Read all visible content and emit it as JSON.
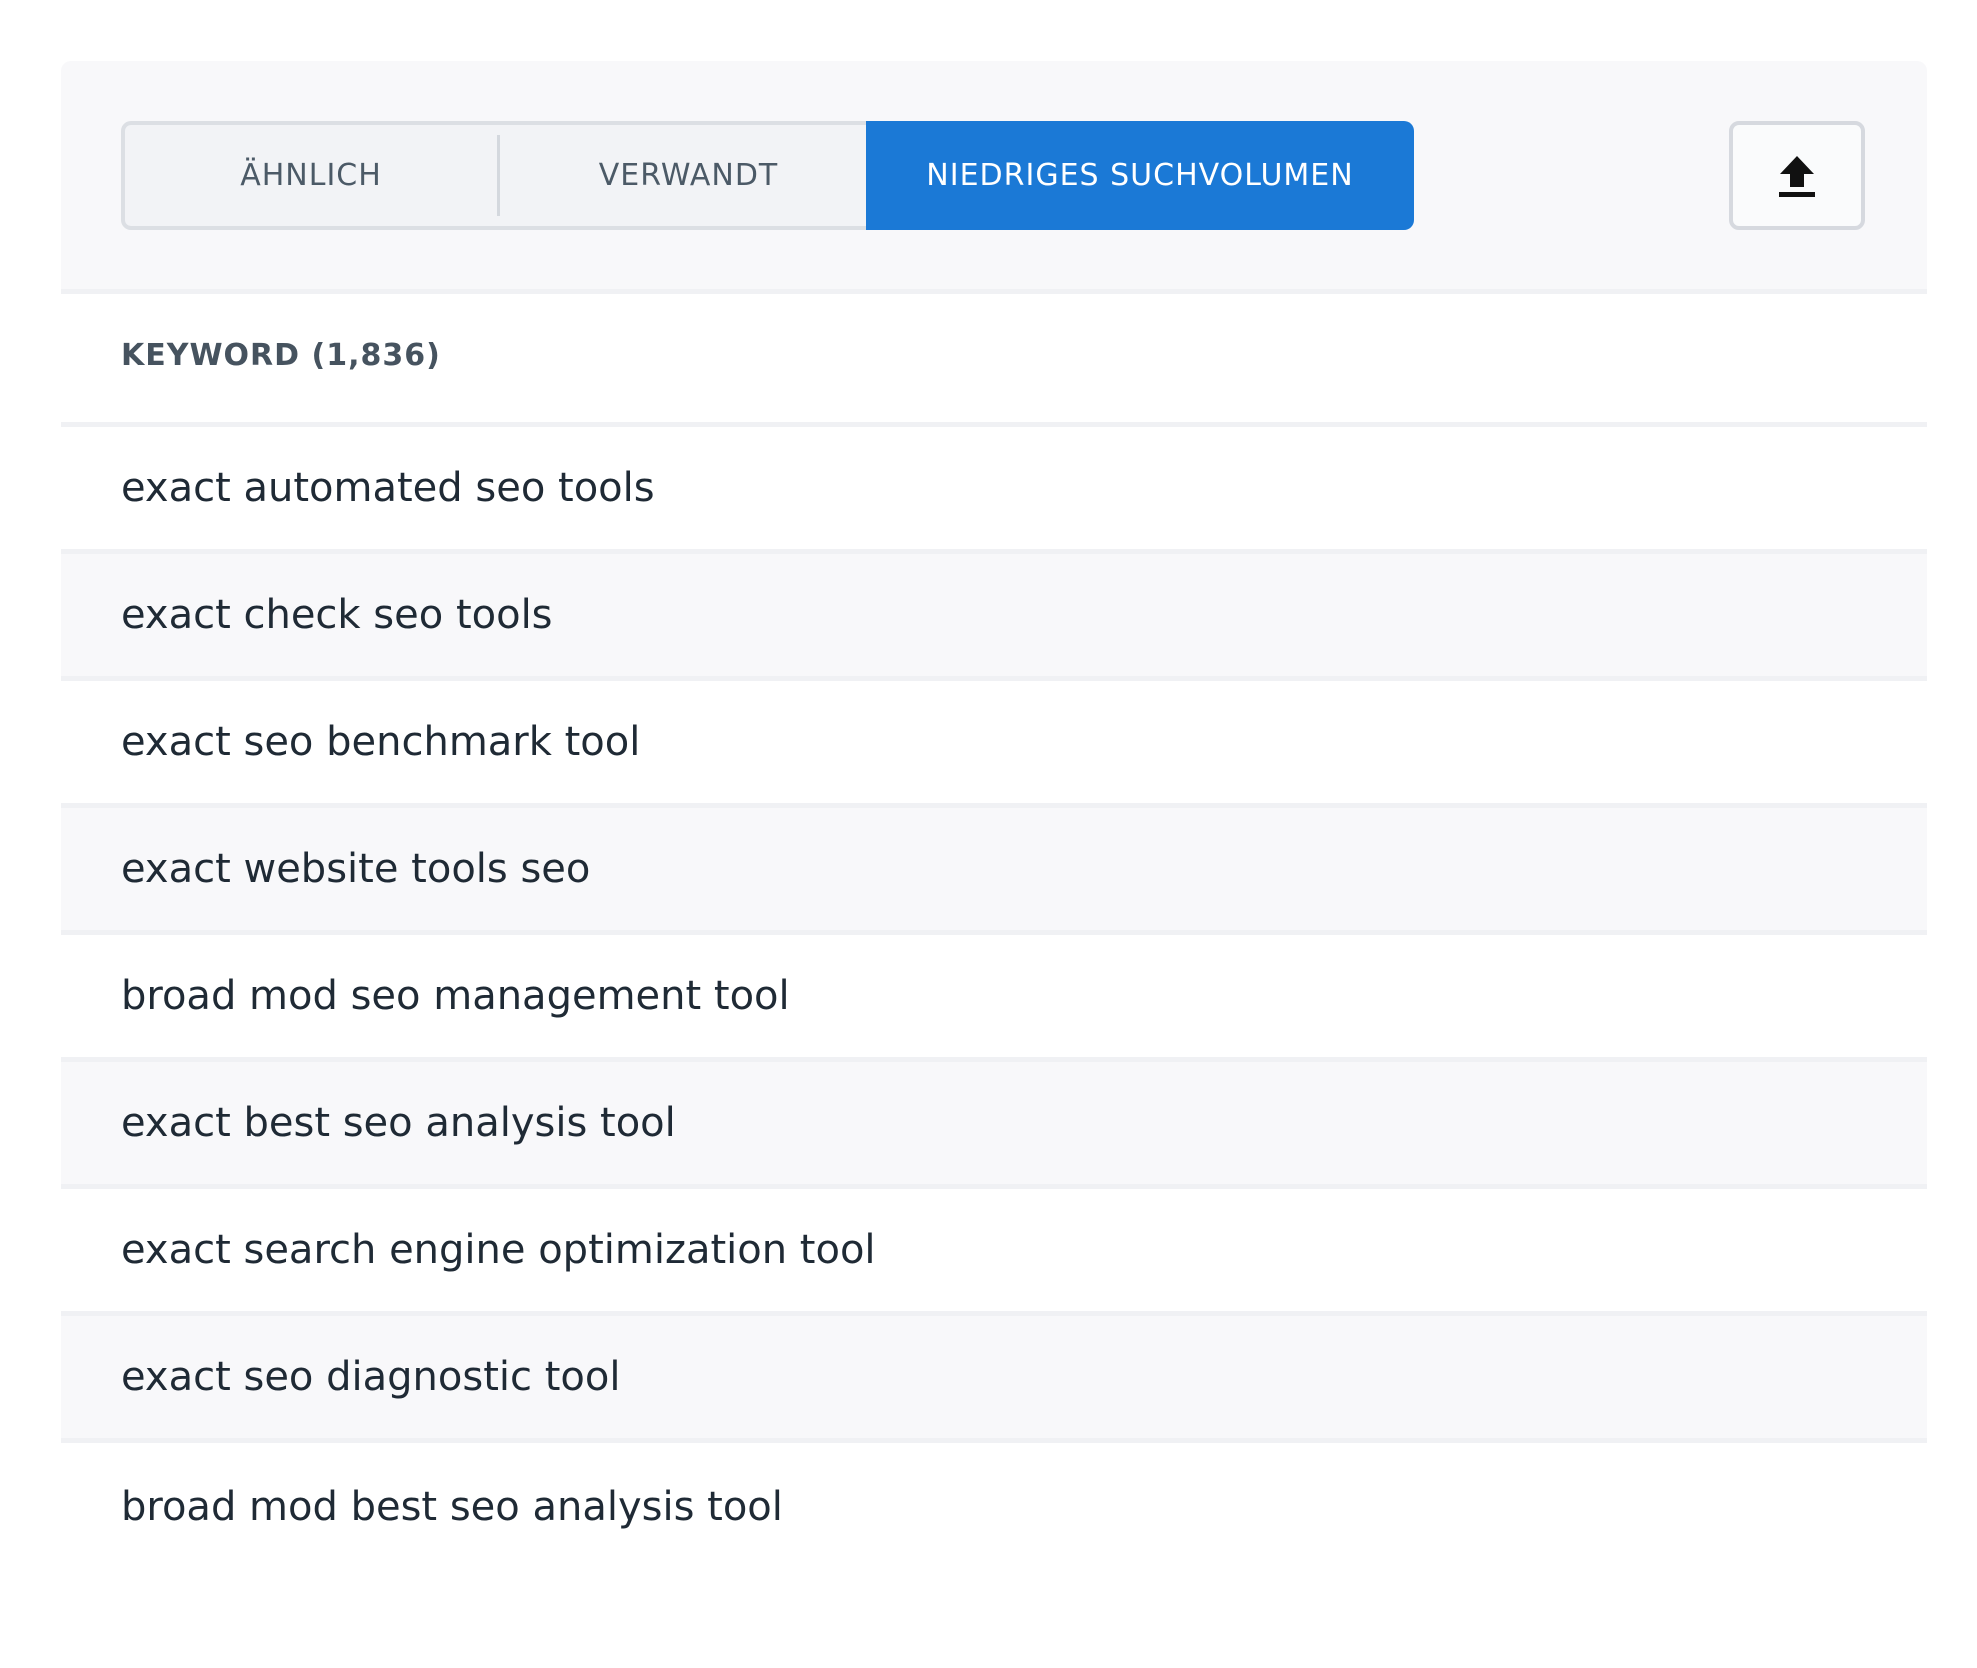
{
  "tabs": {
    "similar_label": "ÄHNLICH",
    "related_label": "VERWANDT",
    "low_volume_label": "NIEDRIGES SUCHVOLUMEN",
    "active": "NIEDRIGES SUCHVOLUMEN"
  },
  "toolbar": {
    "export_icon": "upload-arrow-icon"
  },
  "table": {
    "header": "KEYWORD (1,836)",
    "rows": [
      "exact automated seo tools",
      "exact check seo tools",
      "exact seo benchmark tool",
      "exact website tools seo",
      "broad mod seo management tool",
      "exact best seo analysis tool",
      "exact search engine optimization tool",
      "exact seo diagnostic tool",
      "broad mod best seo analysis tool"
    ]
  },
  "colors": {
    "accent": "#1b79d6",
    "text": "#1f2a35",
    "header_text": "#46535f",
    "tab_text": "#4c5a67"
  }
}
